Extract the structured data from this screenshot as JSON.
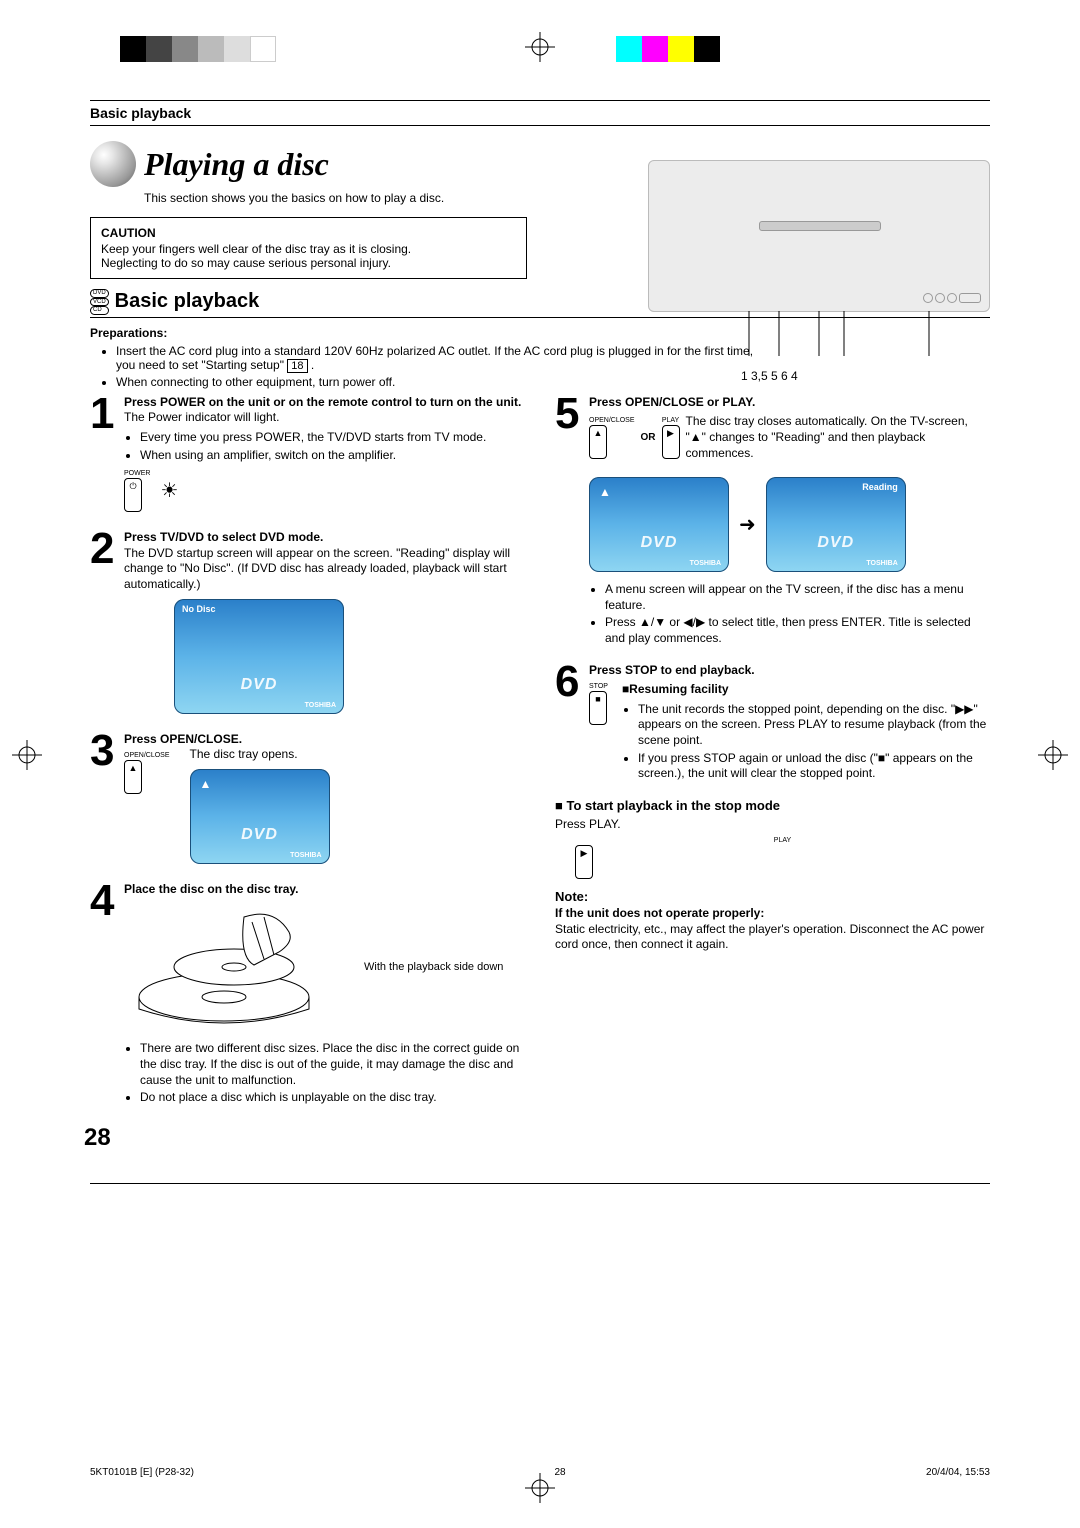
{
  "header": {
    "section_label": "Basic playback"
  },
  "title": "Playing a disc",
  "intro": "This section shows you the basics on how to play a disc.",
  "caution": {
    "heading": "CAUTION",
    "l1": "Keep your fingers well clear of the disc tray as it is closing.",
    "l2": "Neglecting to do so may cause serious personal injury."
  },
  "device_labels": "1  3,5   5   6          4",
  "media": {
    "dvd": "DVD",
    "vcd": "VCD",
    "cd": "CD"
  },
  "section_heading": "Basic playback",
  "prep": {
    "heading": "Preparations:",
    "b1a": "Insert the AC cord plug into a standard 120V 60Hz polarized AC outlet. If the AC cord plug is plugged in for the first time,",
    "b1b": "you need to set \"Starting setup\" ",
    "b1_ref": "18",
    "b1c": ".",
    "b2": "When connecting to other equipment, turn power off."
  },
  "steps": {
    "s1": {
      "h1": "Press POWER on the unit or on the remote control to turn on the unit",
      "l1": "The Power indicator will light.",
      "b1": "Every time you press POWER, the TV/DVD starts from TV mode.",
      "b2": "When using an amplifier, switch on the amplifier.",
      "btn_power": "POWER"
    },
    "s2": {
      "h": "Press TV/DVD to select DVD mode.",
      "l1": "The DVD startup screen will appear on the screen. \"Reading\" display will change to \"No Disc\". (If DVD disc has already loaded, playback will start automatically.)",
      "screen_label": "No Disc",
      "screen_dvd": "DVD",
      "screen_brand": "TOSHIBA"
    },
    "s3": {
      "h": "Press OPEN/CLOSE.",
      "l1": "The disc tray opens.",
      "btn": "OPEN/CLOSE",
      "screen_eject": "▲",
      "screen_dvd": "DVD",
      "screen_brand": "TOSHIBA"
    },
    "s4": {
      "h": "Place the disc on the disc tray.",
      "caption": "With the playback side down",
      "b1": "There are two different disc sizes. Place the disc in the correct guide on the disc tray. If the disc is out of the guide, it may damage the disc and cause the unit to malfunction.",
      "b2": "Do not place a disc which is unplayable on the disc tray."
    },
    "s5": {
      "h": "Press OPEN/CLOSE or PLAY.",
      "l1": "The disc tray closes automatically. On the TV-screen, \"▲\" changes to \"Reading\" and then playback commences.",
      "btn1": "OPEN/CLOSE",
      "btn2": "PLAY",
      "or": "OR",
      "screen1_eject": "▲",
      "screen2_label": "Reading",
      "b1": "A menu screen will appear on the TV screen, if the disc has a menu feature.",
      "b2": "Press ▲/▼ or ◀/▶ to select title, then press ENTER. Title is selected and play commences."
    },
    "s6": {
      "h": "Press STOP to end playback.",
      "btn": "STOP",
      "resume_h": "■Resuming facility",
      "rb1": "The unit records the stopped point, depending on the disc. \"▶▶\" appears on the screen. Press PLAY to resume playback (from the scene point.",
      "rb2": "If you press STOP again or unload the disc (\"■\" appears on the screen.), the unit will clear the stopped point."
    }
  },
  "start_playback": {
    "h": "■ To start playback in the stop mode",
    "l1": "Press PLAY.",
    "btn": "PLAY"
  },
  "note": {
    "h": "Note:",
    "sub": "If the unit does not operate properly:",
    "l1": "Static electricity, etc., may affect the player's operation. Disconnect the AC power cord once, then connect it again."
  },
  "page_number": "28",
  "footer": {
    "left": "5KT0101B [E] (P28-32)",
    "center": "28",
    "right": "20/4/04, 15:53"
  }
}
